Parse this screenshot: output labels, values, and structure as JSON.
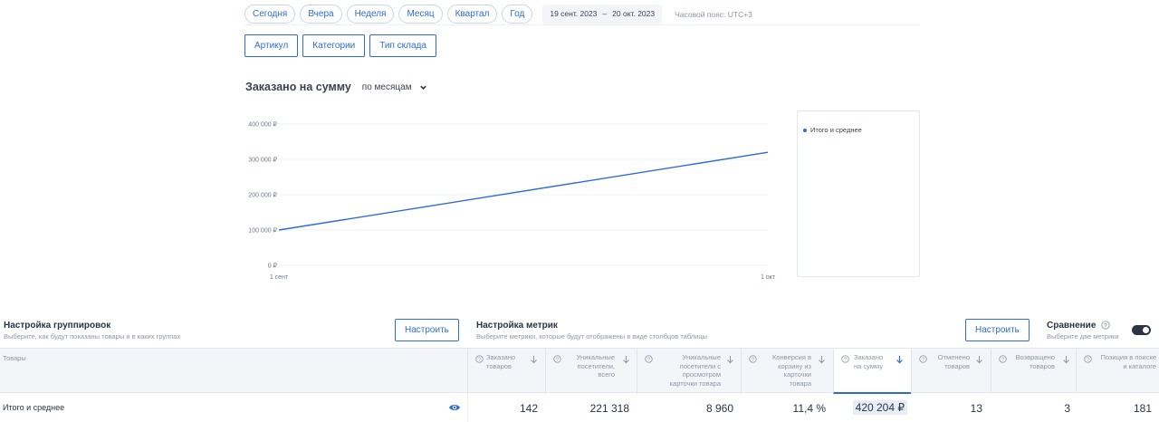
{
  "filters": {
    "periods": [
      "Сегодня",
      "Вчера",
      "Неделя",
      "Месяц",
      "Квартал",
      "Год"
    ],
    "date_from": "19 сент. 2023",
    "date_sep": "–",
    "date_to": "20 окт. 2023",
    "timezone": "Часовой пояс: UTC+3"
  },
  "grouping_tabs": [
    "Артикул",
    "Категории",
    "Тип склада"
  ],
  "chart_header": {
    "title": "Заказано на сумму",
    "period": "по месяцам"
  },
  "chart_data": {
    "type": "line",
    "x": [
      "1 сент",
      "1 окт"
    ],
    "y_ticks": [
      "0 ₽",
      "100 000 ₽",
      "200 000 ₽",
      "300 000 ₽",
      "400 000 ₽"
    ],
    "ylim": [
      0,
      400000
    ],
    "series": [
      {
        "name": "Итого и среднее",
        "values": [
          100000,
          320000
        ],
        "color": "#2f6bd6"
      }
    ],
    "legend": "right",
    "grid": true
  },
  "grouping_settings": {
    "title": "Настройка группировок",
    "subtitle": "Выберите, как будут показаны товары и в каких группах",
    "button": "Настроить"
  },
  "metric_settings": {
    "title": "Настройка метрик",
    "subtitle": "Выберите метрики, которые будут отображены в виде столбцов таблицы",
    "button": "Настроить"
  },
  "comparison": {
    "title": "Сравнение",
    "subtitle": "Выберите две метрики",
    "enabled": true
  },
  "table": {
    "goods_header": "Товары",
    "columns": [
      {
        "label": "Заказано товаров",
        "value": "142"
      },
      {
        "label": "Уникальные посетители, всего",
        "value": "221 318"
      },
      {
        "label": "Уникальные посетители с просмотром карточки товара",
        "value": "8 960"
      },
      {
        "label": "Конверсия в корзину из карточки товара",
        "value": "11,4 %"
      },
      {
        "label": "Заказано на сумму",
        "value": "420 204 ₽"
      },
      {
        "label": "Отменено товаров",
        "value": "13"
      },
      {
        "label": "Возвращено товаров",
        "value": "3"
      },
      {
        "label": "Позиция в поиске и каталоге",
        "value": "181"
      }
    ],
    "row_name": "Итого и среднее"
  }
}
